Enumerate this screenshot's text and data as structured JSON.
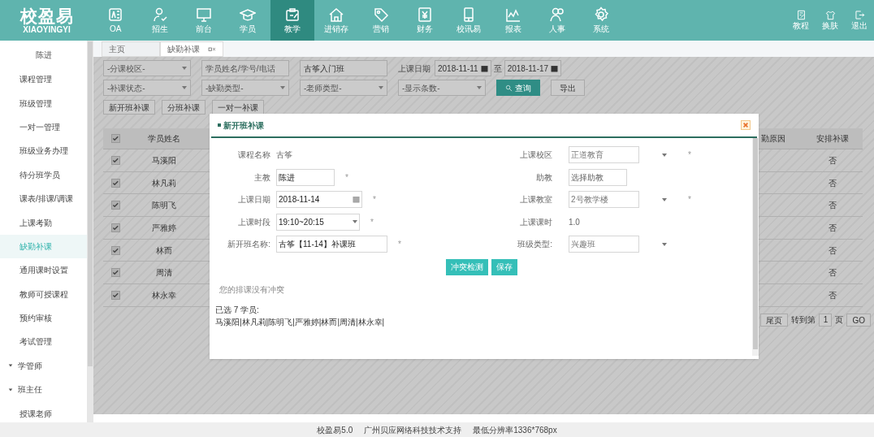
{
  "nav": {
    "logo": {
      "title": "校盈易",
      "subtitle": "XIAOYINGYI"
    },
    "items": [
      {
        "label": "OA",
        "selected": false
      },
      {
        "label": "招生",
        "selected": false
      },
      {
        "label": "前台",
        "selected": false
      },
      {
        "label": "学员",
        "selected": false
      },
      {
        "label": "教学",
        "selected": true
      },
      {
        "label": "进销存",
        "selected": false
      },
      {
        "label": "营销",
        "selected": false
      },
      {
        "label": "财务",
        "selected": false
      },
      {
        "label": "校讯易",
        "selected": false
      },
      {
        "label": "报表",
        "selected": false
      },
      {
        "label": "人事",
        "selected": false
      },
      {
        "label": "系统",
        "selected": false
      }
    ],
    "tools": [
      {
        "label": "教程"
      },
      {
        "label": "换肤"
      },
      {
        "label": "退出"
      }
    ]
  },
  "sidebar": {
    "user": {
      "name": "陈进"
    },
    "items": [
      {
        "kind": "link",
        "label": "课程管理",
        "selected": false
      },
      {
        "kind": "link",
        "label": "班级管理",
        "selected": false
      },
      {
        "kind": "link",
        "label": "一对一管理",
        "selected": false
      },
      {
        "kind": "link",
        "label": "班级业务办理",
        "selected": false
      },
      {
        "kind": "link",
        "label": "待分班学员",
        "selected": false
      },
      {
        "kind": "link",
        "label": "课表/排课/调课",
        "selected": false
      },
      {
        "kind": "link",
        "label": "上课考勤",
        "selected": false
      },
      {
        "kind": "link",
        "label": "缺勤补课",
        "selected": true
      },
      {
        "kind": "link",
        "label": "通用课时设置",
        "selected": false
      },
      {
        "kind": "link",
        "label": "教师可授课程",
        "selected": false
      },
      {
        "kind": "link",
        "label": "预约审核",
        "selected": false
      },
      {
        "kind": "link",
        "label": "考试管理",
        "selected": false
      },
      {
        "kind": "group",
        "label": "学管师",
        "expanded": false
      },
      {
        "kind": "group",
        "label": "班主任",
        "expanded": false
      },
      {
        "kind": "link",
        "label": "授课老师",
        "selected": false
      }
    ]
  },
  "page_tabs": [
    {
      "label": "主页",
      "selected": false,
      "closable": false
    },
    {
      "label": "缺勤补课",
      "selected": true,
      "closable": true
    }
  ],
  "filters": {
    "row_1": [
      {
        "kind": "select",
        "placeholder": "-分课校区-"
      },
      {
        "kind": "input",
        "placeholder": "学员姓名/学号/电话"
      },
      {
        "kind": "input",
        "value": "古筝入门班"
      },
      {
        "kind": "daterange",
        "label": "上课日期",
        "from": "2018-11-11",
        "separator": "至",
        "to": "2018-11-17"
      }
    ],
    "row_2": [
      {
        "kind": "select",
        "placeholder": "-补课状态-"
      },
      {
        "kind": "select",
        "placeholder": "-缺勤类型-"
      },
      {
        "kind": "select",
        "placeholder": "-老师类型-"
      },
      {
        "kind": "select",
        "placeholder": "-显示条数-"
      },
      {
        "kind": "button",
        "label": "查询",
        "primary": true
      },
      {
        "kind": "button",
        "label": "导出",
        "primary": false
      }
    ]
  },
  "action_buttons": [
    "新开班补课",
    "分班补课",
    "一对一补课"
  ],
  "table": {
    "header_checked": true,
    "columns": [
      "学员姓名",
      "勤原因",
      "安排补课"
    ],
    "rows": [
      {
        "checked": true,
        "name": "马溪阳",
        "arrange": "否"
      },
      {
        "checked": true,
        "name": "林凡莉",
        "arrange": "否"
      },
      {
        "checked": true,
        "name": "陈明飞",
        "arrange": "否"
      },
      {
        "checked": true,
        "name": "严雅婷",
        "arrange": "否"
      },
      {
        "checked": true,
        "name": "林而",
        "arrange": "否"
      },
      {
        "checked": true,
        "name": "周清",
        "arrange": "否"
      },
      {
        "checked": true,
        "name": "林永幸",
        "arrange": "否"
      }
    ]
  },
  "pagination": {
    "last": "尾页",
    "goto_prefix": "转到第",
    "page": "1",
    "goto_suffix": "页",
    "go": "GO"
  },
  "modal": {
    "title": "新开班补课",
    "rows": [
      {
        "left": {
          "label": "课程名称",
          "kind": "text",
          "value": "古筝"
        },
        "right": {
          "label": "上课校区",
          "kind": "select",
          "value": "正道教育",
          "mark": "*"
        }
      },
      {
        "left": {
          "label": "主教",
          "kind": "input",
          "value": "陈进",
          "mark": "*"
        },
        "right": {
          "label": "助教",
          "kind": "input",
          "placeholder": "选择助教"
        }
      },
      {
        "left": {
          "label": "上课日期",
          "kind": "date",
          "value": "2018-11-14",
          "mark": "*"
        },
        "right": {
          "label": "上课教室",
          "kind": "select",
          "value": "2号教学楼",
          "mark": "*"
        }
      },
      {
        "left": {
          "label": "上课时段",
          "kind": "select",
          "value": "19:10~20:15",
          "mark": "*"
        },
        "right": {
          "label": "上课课时",
          "kind": "text",
          "value": "1.0"
        }
      },
      {
        "left": {
          "label": "新开班名称:",
          "kind": "input",
          "value": "古筝【11-14】补课班",
          "mark": "*"
        },
        "right": {
          "label": "班级类型:",
          "kind": "select",
          "value": "兴趣班"
        }
      }
    ],
    "buttons": [
      "冲突检测",
      "保存"
    ],
    "message": "您的排课没有冲突",
    "selected_summary": "已选 7 学员:",
    "selected_names": "马溪阳|林凡莉|陈明飞|严雅婷|林而|周清|林永幸|"
  },
  "footer": [
    "校盈易5.0",
    "广州贝应网络科技技术支持",
    "最低分辨率1336*768px"
  ]
}
